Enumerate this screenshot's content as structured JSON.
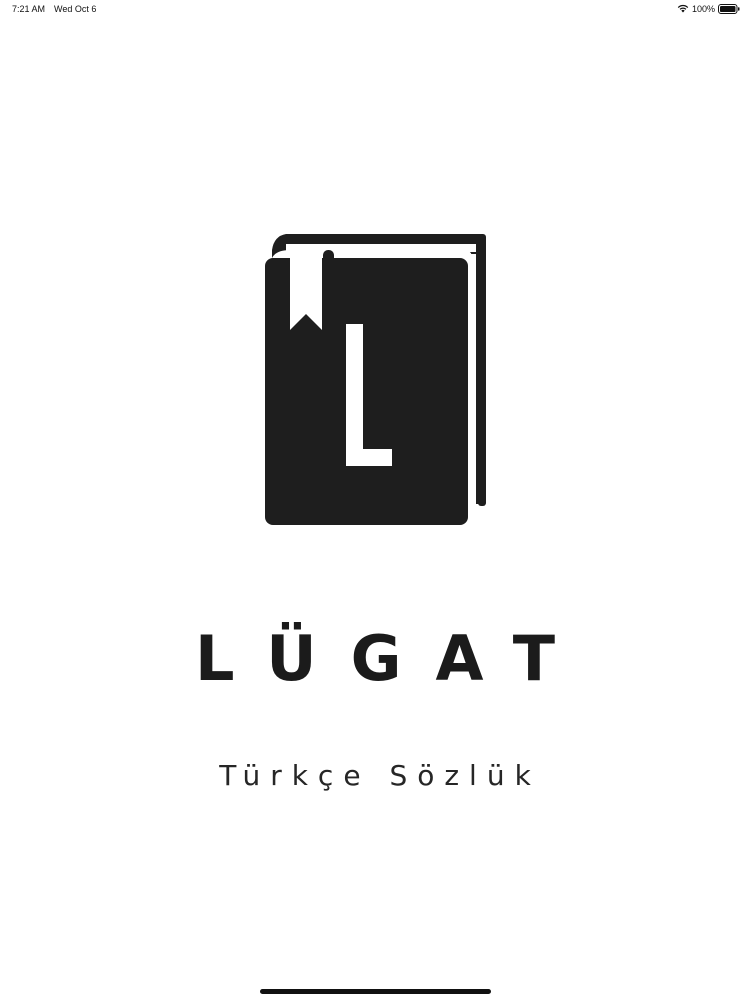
{
  "status_bar": {
    "time": "7:21 AM",
    "date": "Wed Oct 6",
    "battery": "100%",
    "wifi_icon": "wifi-icon",
    "battery_icon": "battery-icon"
  },
  "logo": {
    "icon": "book-bookmark-icon",
    "letter": "L",
    "color": "#1e1e1e"
  },
  "app": {
    "name": "LÜGAT",
    "subtitle": "Türkçe Sözlük"
  }
}
